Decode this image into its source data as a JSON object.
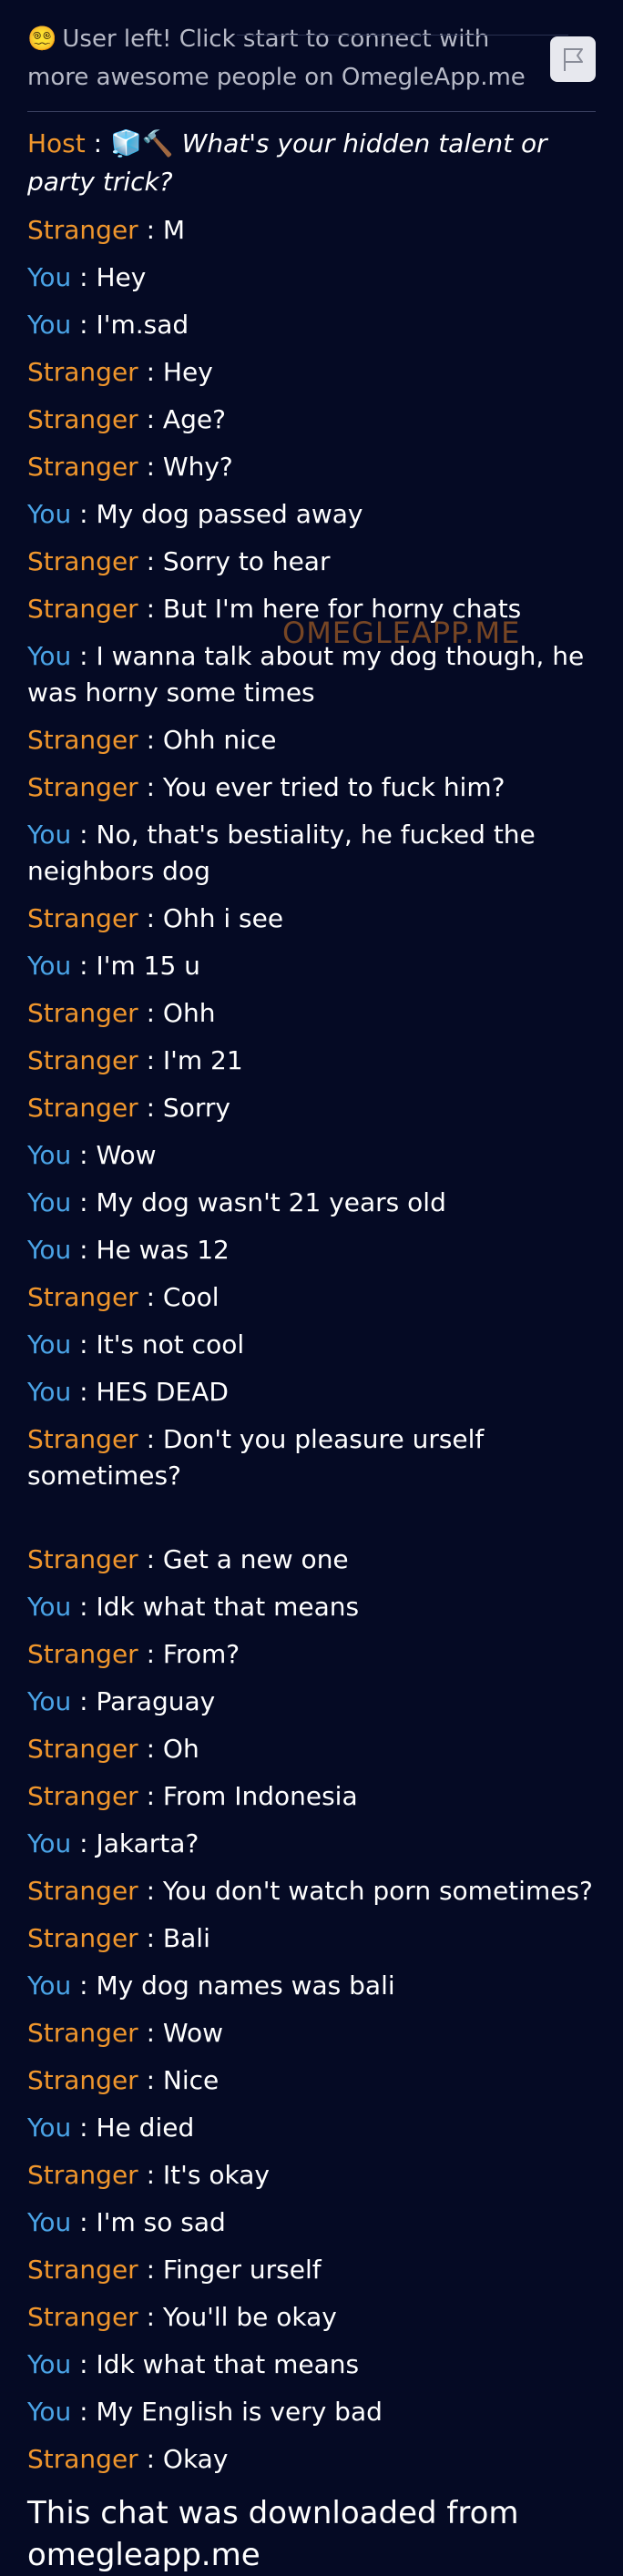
{
  "status": {
    "emoji": "😵‍💫",
    "text": "User left! Click start to connect with more awesome people on OmegleApp.me"
  },
  "flag_button": {
    "icon": "flag-icon"
  },
  "host": {
    "label": "Host",
    "separator": " : ",
    "icons": "🧊🔨",
    "question": "What's your hidden talent or party trick?"
  },
  "watermark": "OMEGLEAPP.ME",
  "colors": {
    "background": "#050a24",
    "stranger": "#f0962c",
    "you": "#4aa3e6",
    "host": "#f0962c"
  },
  "messages": [
    {
      "sender": "Stranger",
      "role": "stranger",
      "text": "M"
    },
    {
      "sender": "You",
      "role": "you",
      "text": "Hey"
    },
    {
      "sender": "You",
      "role": "you",
      "text": "I'm.sad"
    },
    {
      "sender": "Stranger",
      "role": "stranger",
      "text": "Hey"
    },
    {
      "sender": "Stranger",
      "role": "stranger",
      "text": "Age?"
    },
    {
      "sender": "Stranger",
      "role": "stranger",
      "text": "Why?"
    },
    {
      "sender": "You",
      "role": "you",
      "text": "My dog passed away"
    },
    {
      "sender": "Stranger",
      "role": "stranger",
      "text": "Sorry to hear"
    },
    {
      "sender": "Stranger",
      "role": "stranger",
      "text": "But I'm here for horny chats"
    },
    {
      "sender": "You",
      "role": "you",
      "text": "I wanna talk about my dog though, he was horny some times"
    },
    {
      "sender": "Stranger",
      "role": "stranger",
      "text": "Ohh nice"
    },
    {
      "sender": "Stranger",
      "role": "stranger",
      "text": "You ever tried to fuck him?"
    },
    {
      "sender": "You",
      "role": "you",
      "text": "No, that's bestiality, he fucked the neighbors dog"
    },
    {
      "sender": "Stranger",
      "role": "stranger",
      "text": "Ohh i see"
    },
    {
      "sender": "You",
      "role": "you",
      "text": "I'm 15 u"
    },
    {
      "sender": "Stranger",
      "role": "stranger",
      "text": "Ohh"
    },
    {
      "sender": "Stranger",
      "role": "stranger",
      "text": "I'm 21"
    },
    {
      "sender": "Stranger",
      "role": "stranger",
      "text": "Sorry"
    },
    {
      "sender": "You",
      "role": "you",
      "text": "Wow"
    },
    {
      "sender": "You",
      "role": "you",
      "text": "My dog wasn't 21 years old"
    },
    {
      "sender": "You",
      "role": "you",
      "text": "He was 12"
    },
    {
      "sender": "Stranger",
      "role": "stranger",
      "text": "Cool"
    },
    {
      "sender": "You",
      "role": "you",
      "text": "It's not cool"
    },
    {
      "sender": "You",
      "role": "you",
      "text": "HES DEAD"
    },
    {
      "sender": "Stranger",
      "role": "stranger",
      "text": "Don't you pleasure urself sometimes?",
      "gap_after": true
    },
    {
      "sender": "Stranger",
      "role": "stranger",
      "text": "Get a new one"
    },
    {
      "sender": "You",
      "role": "you",
      "text": "Idk what that means"
    },
    {
      "sender": "Stranger",
      "role": "stranger",
      "text": "From?"
    },
    {
      "sender": "You",
      "role": "you",
      "text": "Paraguay"
    },
    {
      "sender": "Stranger",
      "role": "stranger",
      "text": "Oh"
    },
    {
      "sender": "Stranger",
      "role": "stranger",
      "text": "From Indonesia"
    },
    {
      "sender": "You",
      "role": "you",
      "text": "Jakarta?"
    },
    {
      "sender": "Stranger",
      "role": "stranger",
      "text": "You don't watch porn sometimes?"
    },
    {
      "sender": "Stranger",
      "role": "stranger",
      "text": "Bali"
    },
    {
      "sender": "You",
      "role": "you",
      "text": "My dog names was bali"
    },
    {
      "sender": "Stranger",
      "role": "stranger",
      "text": "Wow"
    },
    {
      "sender": "Stranger",
      "role": "stranger",
      "text": "Nice"
    },
    {
      "sender": "You",
      "role": "you",
      "text": "He died"
    },
    {
      "sender": "Stranger",
      "role": "stranger",
      "text": "It's okay"
    },
    {
      "sender": "You",
      "role": "you",
      "text": "I'm so sad"
    },
    {
      "sender": "Stranger",
      "role": "stranger",
      "text": "Finger urself"
    },
    {
      "sender": "Stranger",
      "role": "stranger",
      "text": "You'll be okay"
    },
    {
      "sender": "You",
      "role": "you",
      "text": "Idk what that means"
    },
    {
      "sender": "You",
      "role": "you",
      "text": "My English is very bad"
    },
    {
      "sender": "Stranger",
      "role": "stranger",
      "text": "Okay"
    }
  ],
  "message_separator": " : ",
  "footer": "This chat was downloaded from omegleapp.me"
}
